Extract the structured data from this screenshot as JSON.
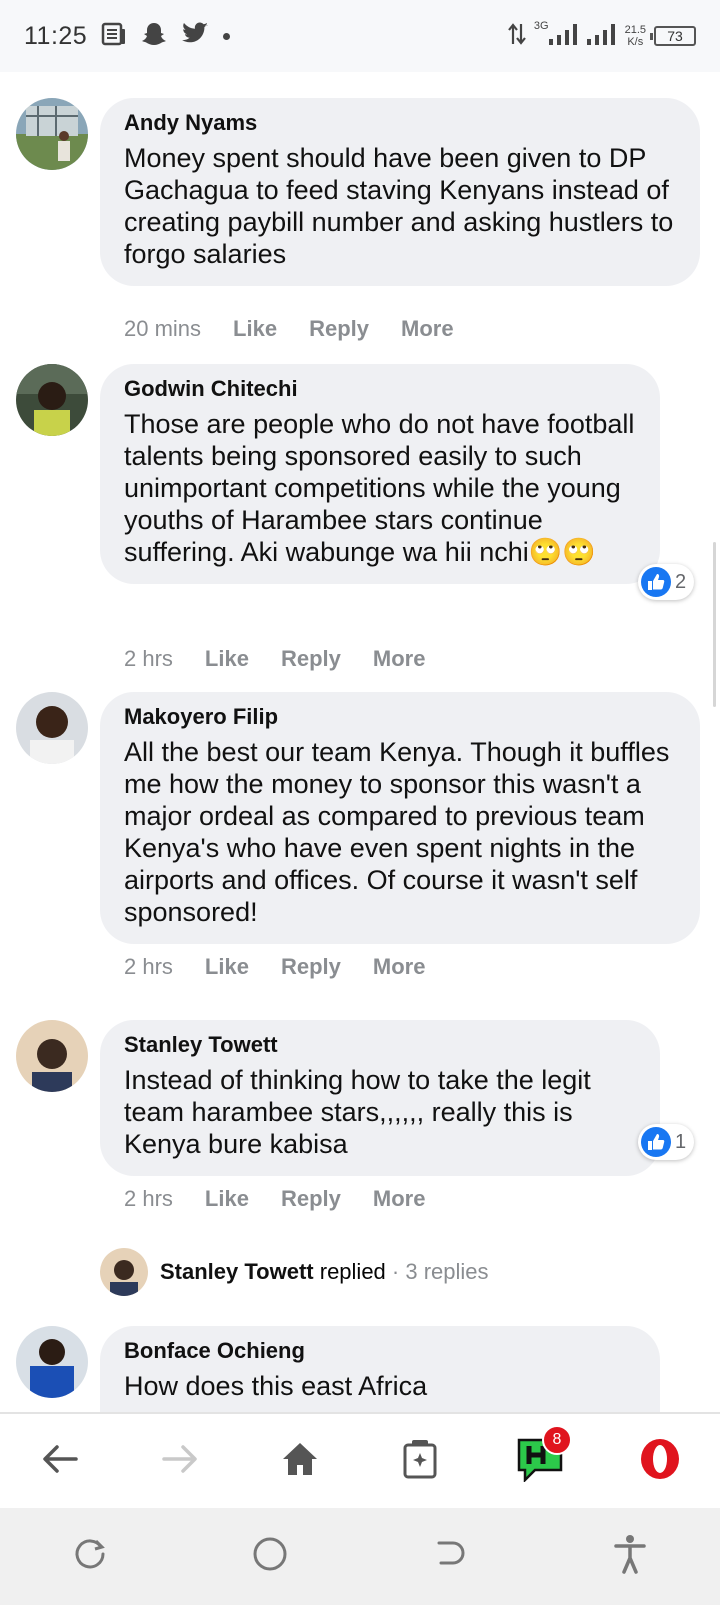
{
  "status_bar": {
    "time": "11:25",
    "network_type": "3G",
    "speed_value": "21.5",
    "speed_unit": "K/s",
    "battery": "73"
  },
  "comments": [
    {
      "author": "Andy Nyams",
      "text": "Money spent should have been given to DP Gachagua to feed staving Kenyans instead of creating paybill number and asking hustlers to forgo salaries",
      "time": "20 mins",
      "like": "Like",
      "reply": "Reply",
      "more": "More"
    },
    {
      "author": "Godwin Chitechi",
      "text": "Those are people who do not have football talents being sponsored easily to such unimportant competitions while the young youths of Harambee stars continue suffering. Aki wabunge wa hii nchi🙄🙄",
      "time": "2 hrs",
      "like": "Like",
      "reply": "Reply",
      "more": "More",
      "reactions": "2"
    },
    {
      "author": "Makoyero Filip",
      "text": "All the best our team Kenya. Though it buffles me how the money to sponsor this wasn't a major ordeal as compared to previous team Kenya's who have even spent nights in the airports and offices. Of course it wasn't self sponsored!",
      "time": "2 hrs",
      "like": "Like",
      "reply": "Reply",
      "more": "More"
    },
    {
      "author": "Stanley Towett",
      "text": "Instead of thinking how to take the legit team harambee stars,,,,,, really this is Kenya bure kabisa",
      "time": "2 hrs",
      "like": "Like",
      "reply": "Reply",
      "more": "More",
      "reactions": "1"
    },
    {
      "author": "Bonface Ochieng",
      "text": "How does this east Africa"
    }
  ],
  "reply_summary": {
    "name": "Stanley Towett",
    "verb": "replied",
    "count": "· 3 replies"
  },
  "browser_bar": {
    "notifications_badge": "8"
  },
  "colors": {
    "bubble": "#eff0f3",
    "like_blue": "#1877f2",
    "opera_red": "#e0141e",
    "muted": "#8a8d91"
  }
}
